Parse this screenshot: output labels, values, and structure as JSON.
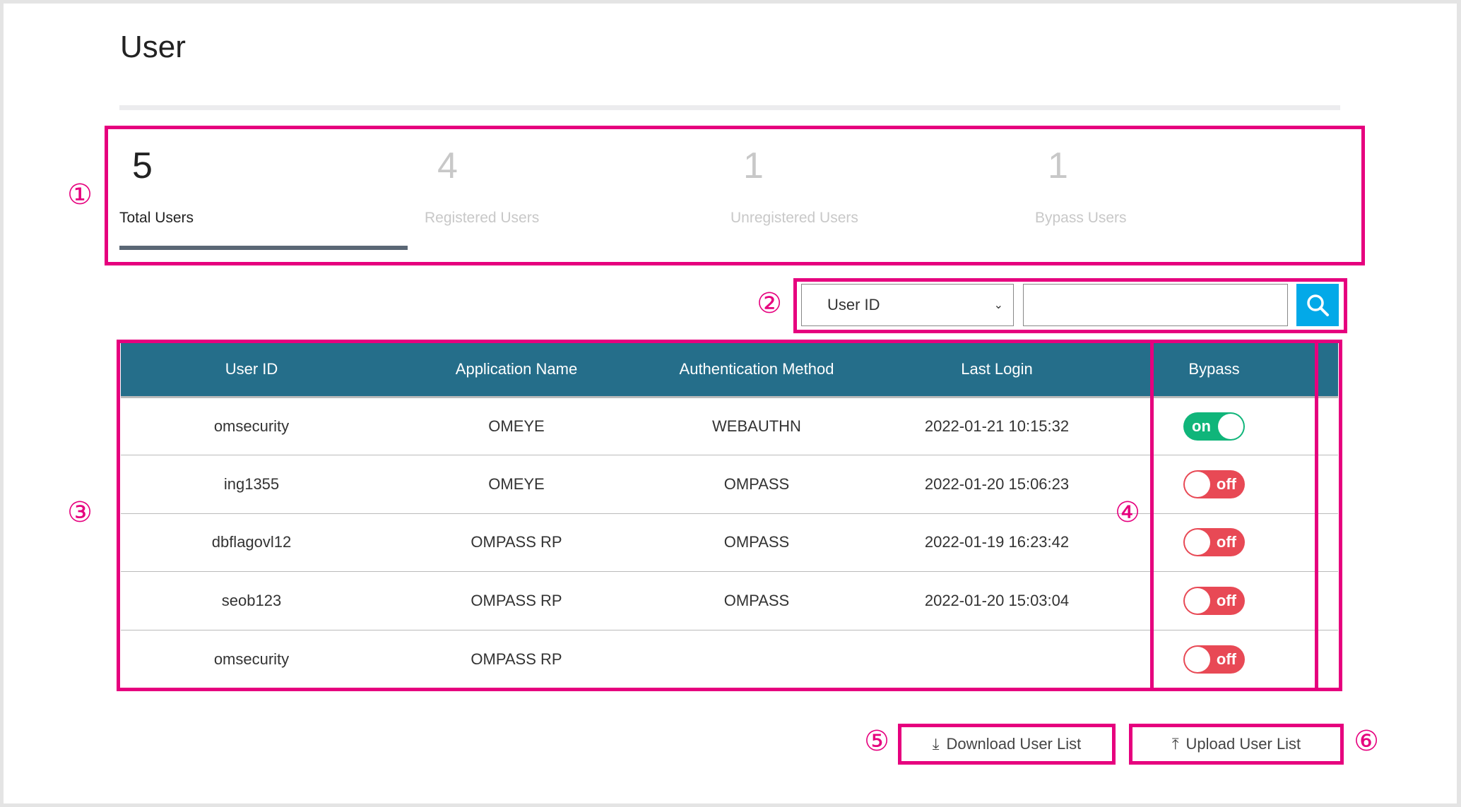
{
  "page": {
    "title": "User"
  },
  "stats": [
    {
      "value": "5",
      "label": "Total Users",
      "active": true
    },
    {
      "value": "4",
      "label": "Registered Users",
      "active": false
    },
    {
      "value": "1",
      "label": "Unregistered Users",
      "active": false
    },
    {
      "value": "1",
      "label": "Bypass Users",
      "active": false
    }
  ],
  "search": {
    "field_selected": "User ID",
    "query": "",
    "search_icon": "search-icon"
  },
  "table": {
    "headers": [
      "User ID",
      "Application Name",
      "Authentication Method",
      "Last Login",
      "Bypass"
    ],
    "rows": [
      {
        "user_id": "omsecurity",
        "app": "OMEYE",
        "method": "WEBAUTHN",
        "last_login": "2022-01-21 10:15:32",
        "bypass": "on"
      },
      {
        "user_id": "ing1355",
        "app": "OMEYE",
        "method": "OMPASS",
        "last_login": "2022-01-20 15:06:23",
        "bypass": "off"
      },
      {
        "user_id": "dbflagovl12",
        "app": "OMPASS RP",
        "method": "OMPASS",
        "last_login": "2022-01-19 16:23:42",
        "bypass": "off"
      },
      {
        "user_id": "seob123",
        "app": "OMPASS RP",
        "method": "OMPASS",
        "last_login": "2022-01-20 15:03:04",
        "bypass": "off"
      },
      {
        "user_id": "omsecurity",
        "app": "OMPASS RP",
        "method": "",
        "last_login": "",
        "bypass": "off"
      }
    ]
  },
  "actions": {
    "download": "Download User List",
    "upload": "Upload User List"
  },
  "annotations": [
    "①",
    "②",
    "③",
    "④",
    "⑤",
    "⑥"
  ],
  "colors": {
    "highlight": "#e6007e",
    "header": "#256e8a",
    "on": "#10b57a",
    "off": "#e84955",
    "search": "#03a9e8"
  }
}
